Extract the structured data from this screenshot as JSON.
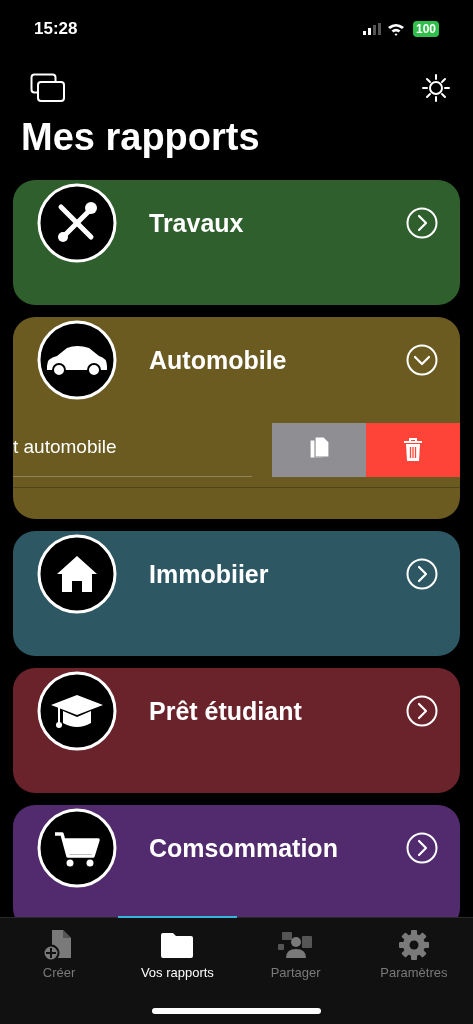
{
  "status_bar": {
    "time": "15:28",
    "battery": "100"
  },
  "title": "Mes rapports",
  "reports": [
    {
      "title": "Travaux",
      "color": "#2e5f2c",
      "expanded": false
    },
    {
      "title": "Automobile",
      "color": "#6c5b20",
      "expanded": true,
      "entries": [
        {
          "label": "t automobile"
        }
      ]
    },
    {
      "title": "Immobiier",
      "color": "#2d5763",
      "expanded": false
    },
    {
      "title": "Prêt étudiant",
      "color": "#6a232b",
      "expanded": false
    },
    {
      "title": "Comsommation",
      "color": "#522b6e",
      "expanded": false
    }
  ],
  "tabs": [
    {
      "label": "Créer",
      "selected": false
    },
    {
      "label": "Vos rapports",
      "selected": true
    },
    {
      "label": "Partager",
      "selected": false
    },
    {
      "label": "Paramètres",
      "selected": false
    }
  ]
}
